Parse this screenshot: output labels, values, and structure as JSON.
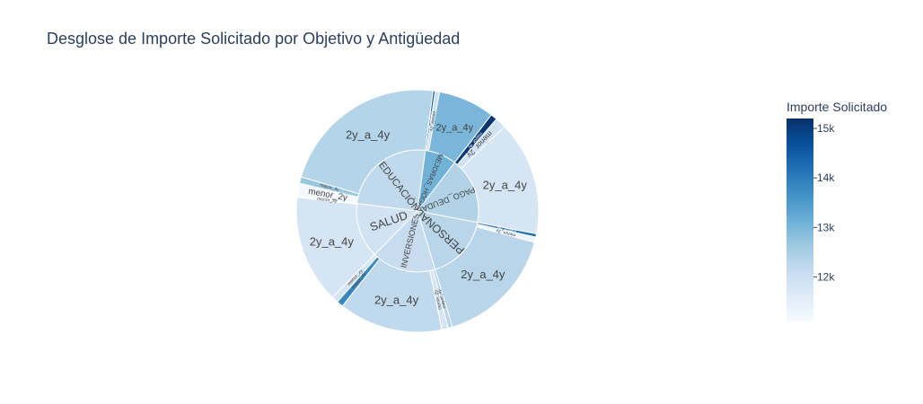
{
  "chart_data": {
    "type": "sunburst",
    "title": "Desglose de Importe Solicitado por Objetivo y Antigüedad",
    "colorbar": {
      "title": "Importe Solicitado",
      "range": [
        11100,
        15200
      ],
      "ticks": [
        {
          "label": "12k",
          "value": 12000
        },
        {
          "label": "13k",
          "value": 13000
        },
        {
          "label": "14k",
          "value": 14000
        },
        {
          "label": "15k",
          "value": 15000
        }
      ],
      "colorscale": [
        "#f7fbff",
        "#deebf7",
        "#c6dbef",
        "#9ecae1",
        "#6baed6",
        "#4292c6",
        "#2171b5",
        "#08519c",
        "#08306b"
      ]
    },
    "groups": [
      {
        "name": "EDUCACIÓN",
        "color_value": 12200,
        "children": [
          {
            "name": "menor_2y",
            "value": 6,
            "color_value": 11150
          },
          {
            "name": "mayor_4y",
            "value": 3,
            "color_value": 12700
          },
          {
            "name": "2y_a_4y",
            "value": 78,
            "color_value": 12350
          }
        ]
      },
      {
        "name": "MEJORAS_HOGAR",
        "color_value": 13100,
        "children": [
          {
            "name": "mayor_4y",
            "value": 1,
            "color_value": 14500
          },
          {
            "name": "menor_2y",
            "value": 2,
            "color_value": 12000
          },
          {
            "name": "2y_a_4y",
            "value": 26,
            "color_value": 13000
          }
        ]
      },
      {
        "name": "PAGO_DEUDAS",
        "color_value": 12400,
        "children": [
          {
            "name": "mayor_4y",
            "value": 3,
            "color_value": 15100
          },
          {
            "name": "menor_2y",
            "value": 5,
            "color_value": 11900
          },
          {
            "name": "2y_a_4y",
            "value": 53,
            "color_value": 11800
          }
        ]
      },
      {
        "name": "PERSONAL",
        "color_value": 12300,
        "children": [
          {
            "name": "mayor_4y",
            "value": 1.5,
            "color_value": 14200
          },
          {
            "name": "menor_2y",
            "value": 2.5,
            "color_value": 11300
          },
          {
            "name": "2y_a_4y",
            "value": 56,
            "color_value": 12300
          }
        ]
      },
      {
        "name": "INVERSIONES",
        "color_value": 12100,
        "children": [
          {
            "name": "mayor_4y",
            "value": 2,
            "color_value": 12300
          },
          {
            "name": "menor_2y",
            "value": 3,
            "color_value": 11800
          },
          {
            "name": "2y_a_4y",
            "value": 48,
            "color_value": 12200
          },
          {
            "name": "mayor_4y",
            "value": 3,
            "color_value": 13800
          },
          {
            "name": "menor_2y",
            "value": 3,
            "color_value": 11800
          }
        ]
      },
      {
        "name": "SALUD",
        "color_value": 11900,
        "children": [
          {
            "name": "2y_a_4y",
            "value": 50,
            "color_value": 11800
          },
          {
            "name": "menor_2y",
            "value": 0.5,
            "color_value": 11150
          }
        ]
      }
    ]
  }
}
